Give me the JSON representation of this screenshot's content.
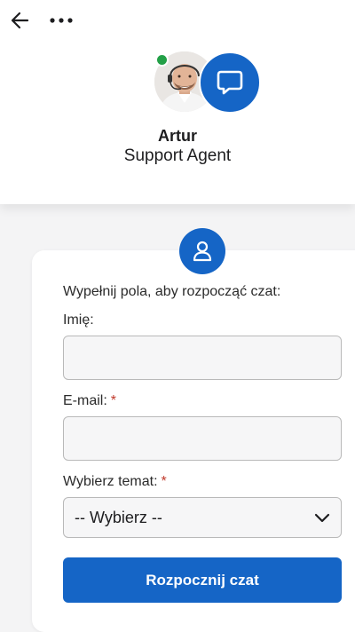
{
  "header": {
    "back_icon": "arrow-left-icon",
    "more_icon": "more-horizontal-icon",
    "agent": {
      "name": "Artur",
      "role": "Support Agent",
      "status_color": "#23a047"
    },
    "brand_icon": "chat-bubble-icon"
  },
  "form": {
    "icon": "user-icon",
    "intro": "Wypełnij pola, aby rozpocząć czat:",
    "fields": [
      {
        "label": "Imię:",
        "required": false,
        "value": "",
        "placeholder": ""
      },
      {
        "label": "E-mail:",
        "required": true,
        "value": "",
        "placeholder": ""
      }
    ],
    "topic": {
      "label": "Wybierz temat:",
      "required": true,
      "selected": "-- Wybierz --"
    },
    "required_mark": "*",
    "submit_label": "Rozpocznij czat"
  },
  "colors": {
    "accent": "#1565c6",
    "required": "#c0392b",
    "background": "#f4f4f5"
  }
}
